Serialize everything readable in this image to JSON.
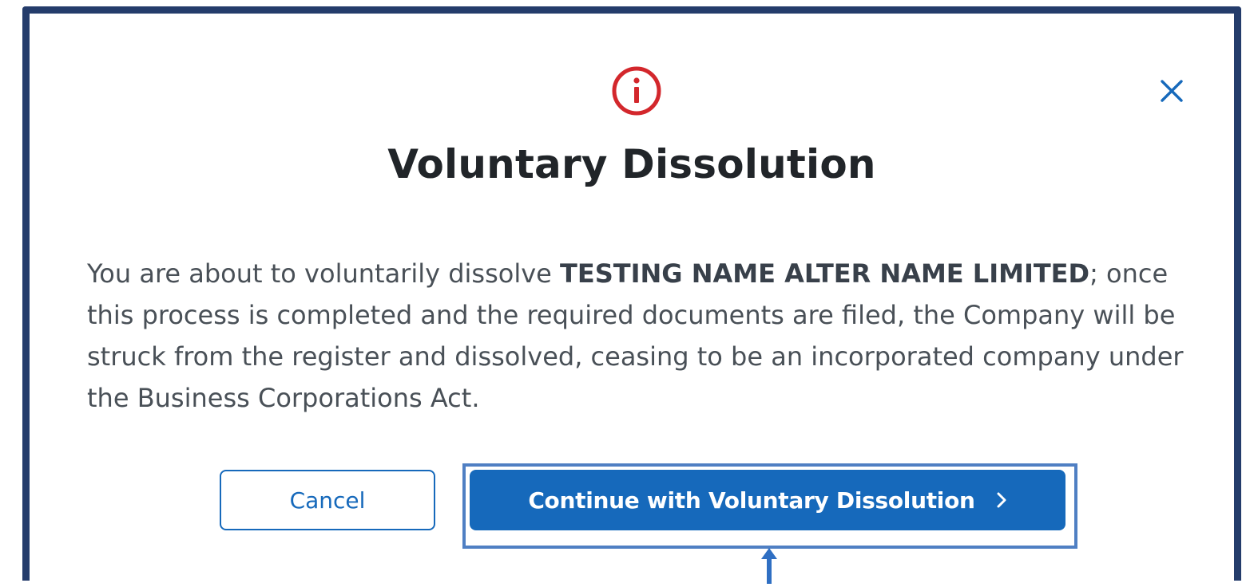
{
  "dialog": {
    "icon": "info-circle-icon",
    "close_icon": "close-icon",
    "title": "Voluntary Dissolution",
    "message": {
      "prefix": "You are about to voluntarily dissolve ",
      "entity_name": "TESTING NAME ALTER NAME LIMITED",
      "suffix": "; once this process is completed and the required documents are filed, the Company will be struck from the register and dissolved, ceasing to be an incorporated company under the Business Corporations Act."
    },
    "buttons": {
      "cancel_label": "Cancel",
      "continue_label": "Continue with Voluntary Dissolution",
      "continue_icon": "chevron-right-icon"
    }
  },
  "colors": {
    "frame_border": "#243c6b",
    "primary": "#1669bb",
    "warning_icon": "#d3272c",
    "highlight": "#4f7fc3",
    "title_text": "#212529",
    "body_text": "#495057"
  }
}
